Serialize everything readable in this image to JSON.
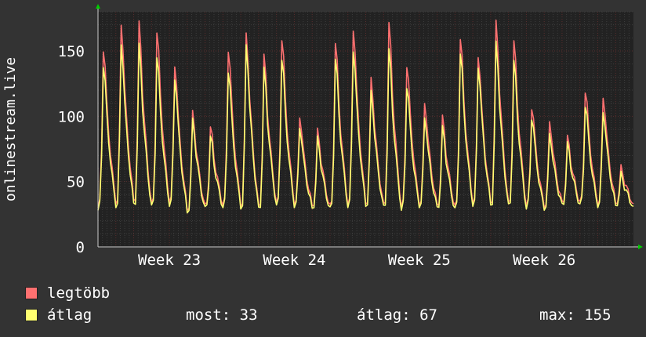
{
  "colors": {
    "background": "#333333",
    "plot_background": "#222222",
    "grid_major": "#5a2e2e",
    "grid_minor": "#3d3d3d",
    "text": "#ffffff",
    "axis_arrow": "#00cc00",
    "max_series": "#ff7070",
    "avg_series": "#ffff70"
  },
  "legend": {
    "max_label": "legtöbb",
    "avg_label": "átlag"
  },
  "stats": {
    "current": "most: 33",
    "average": "átlag: 67",
    "maximum": "max: 155"
  },
  "chart_data": {
    "type": "line",
    "title": "",
    "ylabel": "onlinestream.live",
    "xlabel": "",
    "ylim": [
      0,
      180
    ],
    "yticks": [
      0,
      50,
      100,
      150
    ],
    "x_tick_labels": [
      "Week 23",
      "Week 24",
      "Week 25",
      "Week 26"
    ],
    "grid": true,
    "legend_position": "bottom-left",
    "days": 30,
    "series": [
      {
        "name": "legtöbb",
        "daily_peak": [
          152,
          170,
          170,
          165,
          140,
          102,
          91,
          152,
          163,
          145,
          160,
          100,
          88,
          156,
          168,
          128,
          170,
          140,
          110,
          98,
          160,
          147,
          171,
          157,
          108,
          95,
          83,
          120,
          115,
          60
        ],
        "daily_min": [
          30,
          33,
          35,
          32,
          34,
          28,
          30,
          32,
          31,
          30,
          33,
          32,
          31,
          30,
          32,
          33,
          31,
          30,
          32,
          31,
          30,
          33,
          34,
          32,
          31,
          30,
          33,
          34,
          32,
          33
        ]
      },
      {
        "name": "átlag",
        "daily_peak": [
          140,
          155,
          153,
          146,
          130,
          96,
          84,
          136,
          154,
          135,
          145,
          92,
          82,
          144,
          152,
          118,
          150,
          124,
          99,
          90,
          149,
          139,
          155,
          142,
          100,
          86,
          78,
          109,
          104,
          55
        ],
        "daily_min": [
          28,
          30,
          32,
          30,
          31,
          26,
          28,
          30,
          29,
          28,
          31,
          30,
          29,
          28,
          30,
          31,
          29,
          28,
          30,
          29,
          28,
          31,
          32,
          30,
          29,
          28,
          31,
          32,
          30,
          31
        ]
      }
    ]
  }
}
